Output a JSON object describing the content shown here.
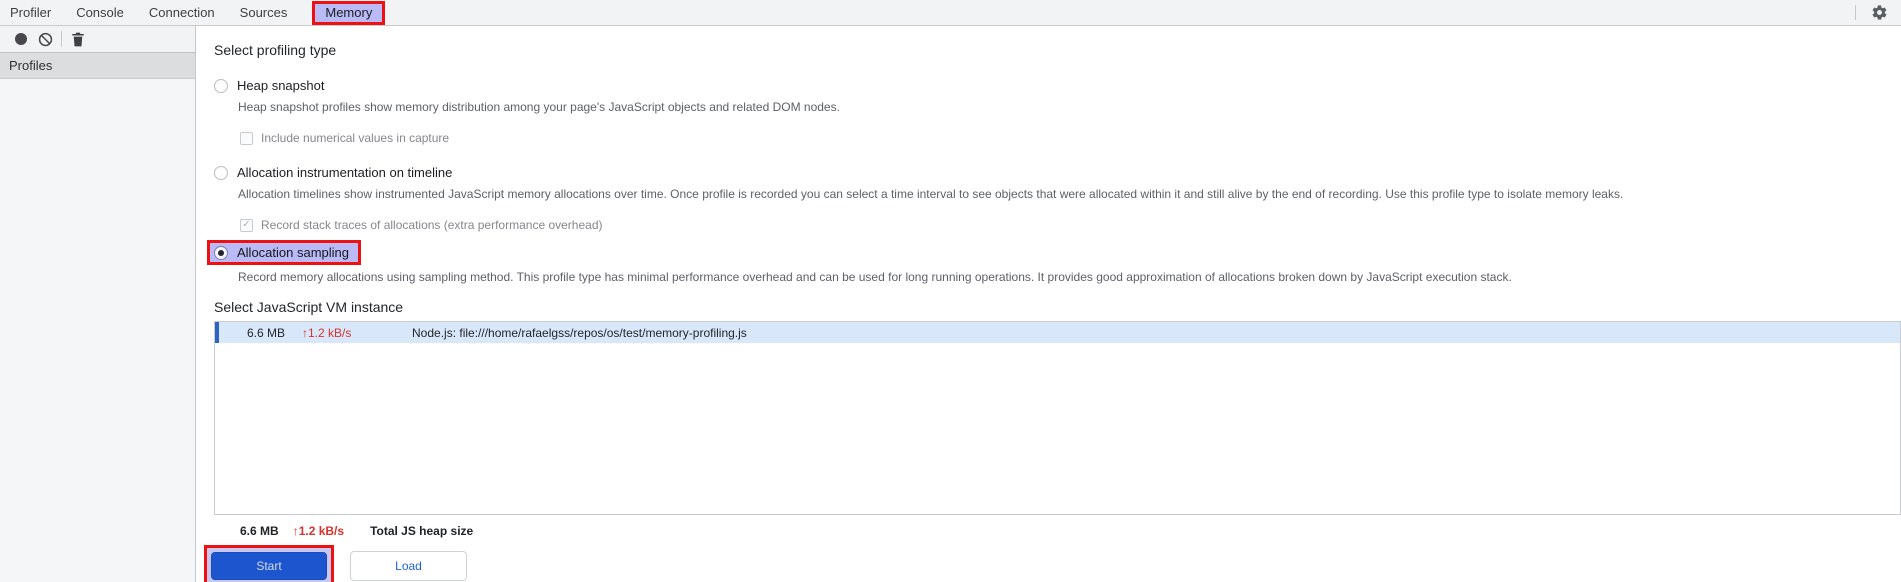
{
  "tabbar": {
    "tabs": [
      {
        "label": "Profiler"
      },
      {
        "label": "Console"
      },
      {
        "label": "Connection"
      },
      {
        "label": "Sources"
      },
      {
        "label": "Memory",
        "active": true,
        "annotated": true
      }
    ]
  },
  "icons": {
    "settings": "gear-icon",
    "record": "record-circle-icon",
    "clear": "block-icon",
    "delete": "trash-icon"
  },
  "sidebar": {
    "header": "Profiles"
  },
  "profiling": {
    "heading": "Select profiling type",
    "options": [
      {
        "label": "Heap snapshot",
        "selected": false,
        "description": "Heap snapshot profiles show memory distribution among your page's JavaScript objects and related DOM nodes.",
        "checkbox": {
          "label": "Include numerical values in capture",
          "checked": false
        }
      },
      {
        "label": "Allocation instrumentation on timeline",
        "selected": false,
        "description": "Allocation timelines show instrumented JavaScript memory allocations over time. Once profile is recorded you can select a time interval to see objects that were allocated within it and still alive by the end of recording. Use this profile type to isolate memory leaks.",
        "checkbox": {
          "label": "Record stack traces of allocations (extra performance overhead)",
          "checked": true,
          "check_glyph": "✓"
        }
      },
      {
        "label": "Allocation sampling",
        "selected": true,
        "annotated": true,
        "description": "Record memory allocations using sampling method. This profile type has minimal performance overhead and can be used for long running operations. It provides good approximation of allocations broken down by JavaScript execution stack."
      }
    ]
  },
  "vm": {
    "heading": "Select JavaScript VM instance",
    "rows": [
      {
        "heap_size": "6.6 MB",
        "rate": "↑1.2 kB/s",
        "target": "Node.js: file:///home/rafaelgss/repos/os/test/memory-profiling.js",
        "selected": true
      }
    ],
    "summary": {
      "heap_size": "6.6 MB",
      "rate": "↑1.2 kB/s",
      "label": "Total JS heap size"
    }
  },
  "actions": {
    "start": "Start",
    "load": "Load"
  },
  "colors": {
    "annotation_red": "#ee1111",
    "highlight_lavender": "#b9baf6",
    "selected_row_bg": "#d8e8fa",
    "selected_row_accent": "#2a66c4",
    "rate_red": "#d4342c",
    "start_button_bg": "#1d55cf",
    "load_button_text": "#1f62d5"
  }
}
